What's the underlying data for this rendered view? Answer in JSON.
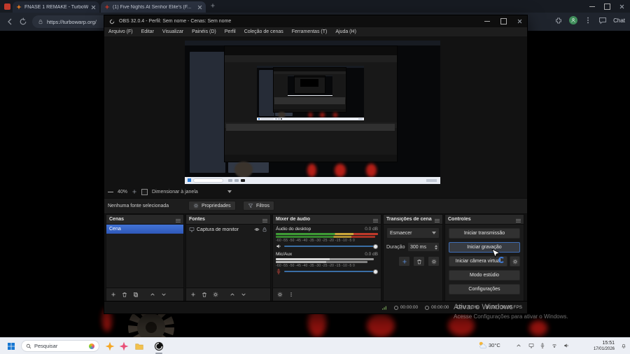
{
  "browser": {
    "tab1": "FNASE 1 REMAKE - TurboWa...",
    "tab2": "(1) Five Nights At Senhor Elite's (F...",
    "url": "https://turbowarp.org/",
    "chat": "Chat"
  },
  "obs": {
    "title": "OBS 32.0.4 - Perfil: Sem nome - Cenas: Sem nome",
    "menu": [
      "Arquivo (F)",
      "Editar",
      "Visualizar",
      "Painéis (D)",
      "Perfil",
      "Coleção de cenas",
      "Ferramentas (T)",
      "Ajuda (H)"
    ],
    "zoom": "40%",
    "fit_label": "Dimensionar à janela",
    "no_source": "Nenhuma fonte selecionada",
    "properties": "Propriedades",
    "filters": "Filtros",
    "scenes": {
      "title": "Cenas",
      "scene1": "Cena"
    },
    "sources": {
      "title": "Fontes",
      "source1": "Captura de monitor"
    },
    "mixer": {
      "title": "Mixer de áudio",
      "ch1_name": "Áudio do desktop",
      "ch1_db": "0.0 dB",
      "ch2_name": "Mic/Aux",
      "ch2_db": "0.0 dB",
      "ticks": "-60 -55 -50 -45 -40 -35 -30 -25 -20 -15 -10 -5 0"
    },
    "transitions": {
      "title": "Transições de cena",
      "value": "Esmaecer",
      "duration_label": "Duração",
      "duration": "300 ms"
    },
    "controls": {
      "title": "Controles",
      "stream": "Iniciar transmissão",
      "record": "Iniciar gravação",
      "vcam": "Iniciar câmera virtual",
      "studio": "Modo estúdio",
      "settings": "Configurações"
    },
    "status": {
      "rec_time": "00:00:00",
      "stream_time": "00:00:00",
      "cpu": "CPU: 0.3%",
      "fps": "30.00 / 30.00 FPS"
    }
  },
  "watermark": {
    "line1": "Ativar o Windows",
    "line2": "Acesse Configurações para ativar o Windows."
  },
  "taskbar": {
    "search": "Pesquisar",
    "temp": "30°C",
    "time": "15:51",
    "date": "17/01/2026"
  },
  "colors": {
    "accent_blue": "#3f6fd0",
    "meter_green": "#3f9c36",
    "meter_yellow": "#cda73a",
    "meter_red": "#c03a2a"
  }
}
